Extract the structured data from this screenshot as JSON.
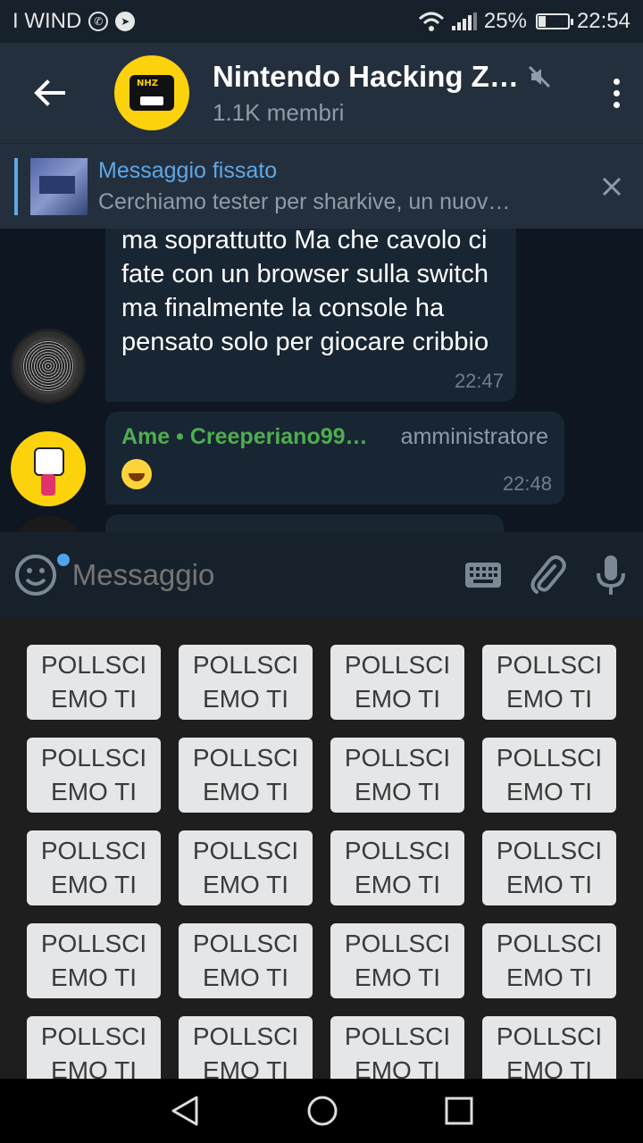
{
  "status_bar": {
    "carrier": "I WIND",
    "battery": "25%",
    "battery_level": 0.25,
    "time": "22:54"
  },
  "header": {
    "title": "Nintendo Hacking Z…",
    "subtitle": "1.1K membri",
    "avatar_text": "NHZ"
  },
  "pinned": {
    "title": "Messaggio fissato",
    "body": "Cerchiamo tester per sharkive, un nuov…"
  },
  "messages": [
    {
      "text": "ma soprattutto Ma che cavolo ci fate con un browser sulla switch ma finalmente la console ha pensato solo per giocare cribbio",
      "time": "22:47"
    },
    {
      "sender": "Ame • Creeperiano99…",
      "role": "amministratore",
      "time": "22:48"
    }
  ],
  "input": {
    "placeholder": "Messaggio"
  },
  "keyboard": {
    "buttons": [
      "POLLSCI EMO TI",
      "POLLSCI EMO TI",
      "POLLSCI EMO TI",
      "POLLSCI EMO TI",
      "POLLSCI EMO TI",
      "POLLSCI EMO TI",
      "POLLSCI EMO TI",
      "POLLSCI EMO TI",
      "POLLSCI EMO TI",
      "POLLSCI EMO TI",
      "POLLSCI EMO TI",
      "POLLSCI EMO TI",
      "POLLSCI EMO TI",
      "POLLSCI EMO TI",
      "POLLSCI EMO TI",
      "POLLSCI EMO TI",
      "POLLSCI EMO TI",
      "POLLSCI EMO TI",
      "POLLSCI EMO TI",
      "POLLSCI EMO TI"
    ]
  },
  "colors": {
    "accent": "#5ea8e6",
    "sender": "#4fae4e",
    "bubble": "#182533",
    "header": "#242f3d"
  }
}
